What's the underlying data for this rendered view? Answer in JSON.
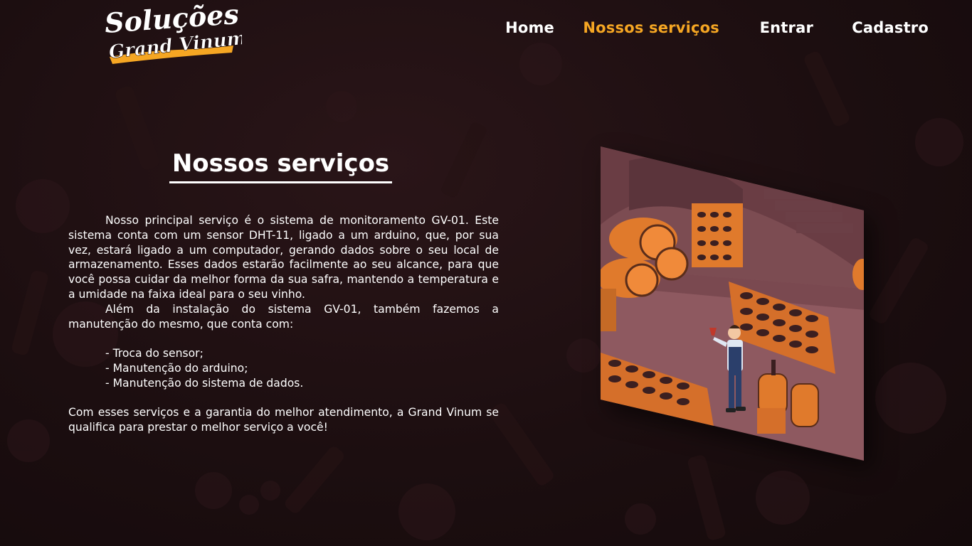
{
  "header": {
    "logo_text_line1": "Soluções",
    "logo_text_line2": "Grand Vinum",
    "nav": [
      {
        "label": "Home",
        "active": false
      },
      {
        "label": "Nossos serviços",
        "active": true
      },
      {
        "label": "Entrar",
        "active": false
      },
      {
        "label": "Cadastro",
        "active": false
      }
    ]
  },
  "main": {
    "title": "Nossos serviços",
    "paragraphs": [
      "Nosso principal serviço é o sistema de monitoramento GV-01. Este sistema conta com um sensor DHT-11, ligado a um arduino, que, por sua vez, estará ligado a um computador, gerando dados sobre o seu local de armazenamento. Esses dados estarão facilmente ao seu alcance, para que você possa cuidar da melhor forma da sua safra, mantendo a temperatura e a umidade na faixa ideal para o seu vinho.",
      "Além da instalação do sistema GV-01, também fazemos a manutenção do mesmo, que conta com:"
    ],
    "services_list": [
      "- Troca do sensor;",
      "- Manutenção do arduino;",
      "- Manutenção do sistema de dados."
    ],
    "closing": "Com esses serviços e a garantia do melhor atendimento, a Grand Vinum se qualifica para prestar o melhor serviço a você!"
  },
  "colors": {
    "accent": "#f5a623",
    "background": "#1c0e10",
    "text": "#ffffff"
  },
  "icons": [
    "logo-icon",
    "wine-cellar-illustration"
  ]
}
